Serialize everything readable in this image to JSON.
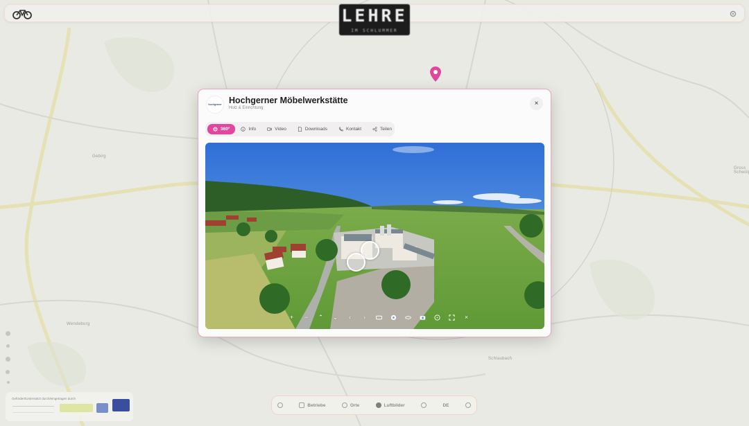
{
  "brand": {
    "title": "LEHRE",
    "subtitle": "IM SCHLUMMER"
  },
  "map": {
    "labels": [
      "Gebirg",
      "Wendeburg",
      "Schlaubach",
      "Gross Schwülper"
    ]
  },
  "sponsor": {
    "text": "Gefördert/Unterstützt durch/eingetragen durch"
  },
  "bottom_bar": {
    "items": [
      {
        "label": "Betriebe",
        "icon": "store-icon"
      },
      {
        "label": "Orte",
        "icon": "pin-icon"
      },
      {
        "label": "Luftbilder",
        "icon": "globe-icon"
      },
      {
        "label": "",
        "icon": "moon-icon"
      },
      {
        "label": "DE",
        "icon": "language-icon"
      },
      {
        "label": "",
        "icon": "info-icon"
      }
    ]
  },
  "modal": {
    "logo_text": "hochgerner",
    "title": "Hochgerner Möbelwerkstätte",
    "subtitle": "Holz & Einrichtung",
    "close": "×",
    "tabs": [
      {
        "label": "360°",
        "icon": "panorama-icon",
        "active": true
      },
      {
        "label": "Info",
        "icon": "info-icon",
        "active": false
      },
      {
        "label": "Video",
        "icon": "video-icon",
        "active": false
      },
      {
        "label": "Downloads",
        "icon": "document-icon",
        "active": false
      },
      {
        "label": "Kontakt",
        "icon": "phone-icon",
        "active": false
      },
      {
        "label": "Teilen",
        "icon": "share-icon",
        "active": false
      }
    ],
    "viewer_controls": [
      {
        "symbol": "+",
        "icon": "zoom-in-icon"
      },
      {
        "symbol": "−",
        "icon": "zoom-out-icon"
      },
      {
        "symbol": "⌃",
        "icon": "pan-up-icon"
      },
      {
        "symbol": "⌄",
        "icon": "pan-down-icon"
      },
      {
        "symbol": "‹",
        "icon": "pan-left-icon"
      },
      {
        "symbol": "›",
        "icon": "pan-right-icon"
      },
      {
        "symbol": "",
        "icon": "vr-icon"
      },
      {
        "symbol": "",
        "icon": "autorotate-icon"
      },
      {
        "symbol": "",
        "icon": "gyroscope-icon"
      },
      {
        "symbol": "",
        "icon": "camera-icon"
      },
      {
        "symbol": "",
        "icon": "compass-icon"
      },
      {
        "symbol": "",
        "icon": "fullscreen-icon"
      },
      {
        "symbol": "×",
        "icon": "close-viewer-icon"
      }
    ]
  }
}
